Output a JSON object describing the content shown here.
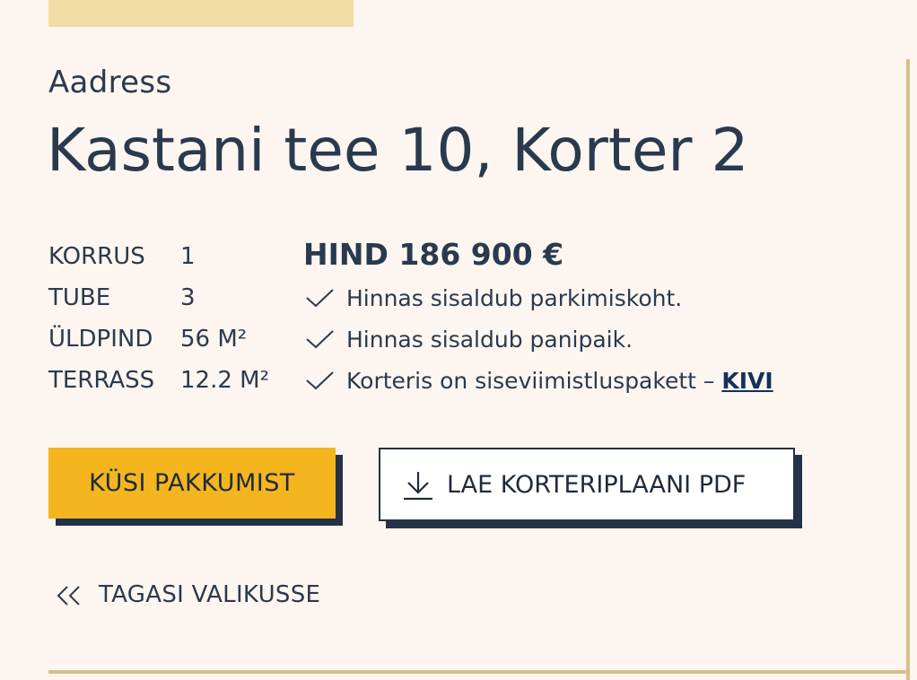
{
  "address_label": "Aadress",
  "title": "Kastani tee 10, Korter 2",
  "specs": [
    {
      "label": "KORRUS",
      "value": "1"
    },
    {
      "label": "TUBE",
      "value": "3"
    },
    {
      "label": "ÜLDPIND",
      "value": "56 M²"
    },
    {
      "label": "TERRASS",
      "value": "12.2 M²"
    }
  ],
  "price": "HIND 186 900 €",
  "features": [
    {
      "text": "Hinnas sisaldub parkimiskoht."
    },
    {
      "text": "Hinnas sisaldub panipaik."
    },
    {
      "text": "Korteris on siseviimistluspakett – ",
      "link": "KIVI"
    }
  ],
  "buttons": {
    "request_offer": "KÜSI PAKKUMIST",
    "download_pdf": "LAE KORTERIPLAANI PDF"
  },
  "back_link": "TAGASI VALIKUSSE",
  "colors": {
    "background": "#fdf6f0",
    "accent_yellow": "#f4b51e",
    "dark_navy": "#243247",
    "border_gold": "#d9bf86",
    "top_accent": "#f2dca5"
  },
  "icons": {
    "check": "check-icon",
    "download": "download-icon",
    "back": "double-chevron-left-icon"
  }
}
